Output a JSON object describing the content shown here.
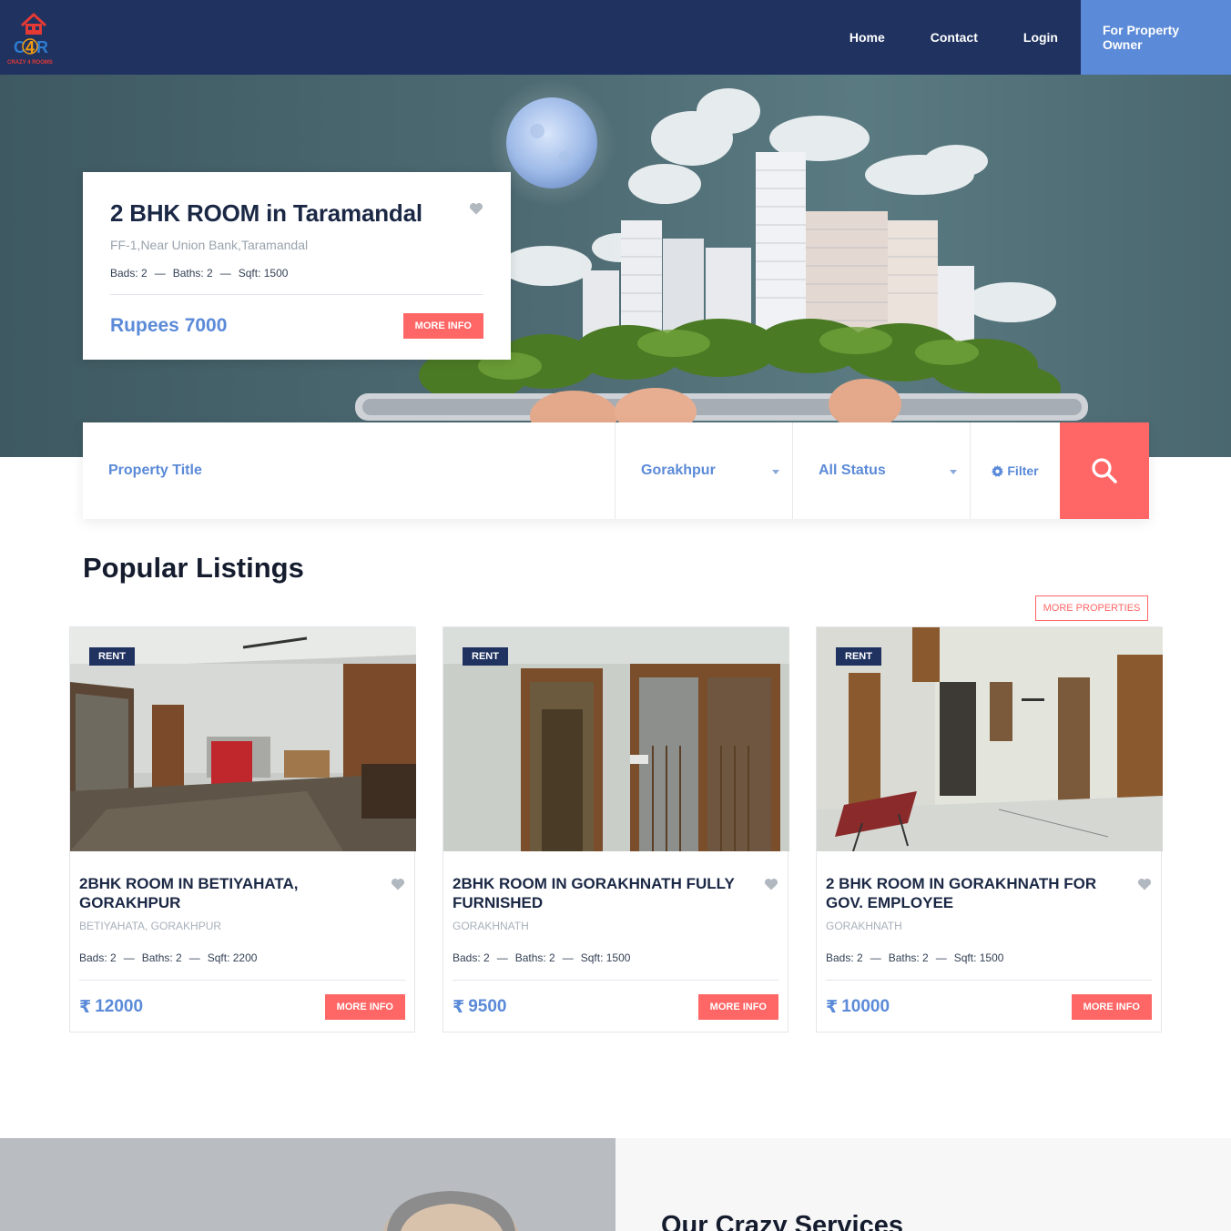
{
  "brand": {
    "logo_text": "C4R",
    "logo_subtext": "CRAZY 4 ROOMS"
  },
  "nav": {
    "items": [
      {
        "label": "Home"
      },
      {
        "label": "Contact"
      },
      {
        "label": "Login"
      },
      {
        "label": "For Property Owner"
      }
    ]
  },
  "featured": {
    "title": "2 BHK ROOM in Taramandal",
    "address": "FF-1,Near Union Bank,Taramandal",
    "beds": "Bads: 2",
    "baths": "Baths: 2",
    "sqft": "Sqft: 1500",
    "price": "Rupees 7000",
    "button": "MORE INFO"
  },
  "search": {
    "title_placeholder": "Property Title",
    "city": "Gorakhpur",
    "status": "All Status",
    "filter_label": "Filter"
  },
  "listings": {
    "heading": "Popular Listings",
    "more_button": "MORE PROPERTIES",
    "items": [
      {
        "badge": "RENT",
        "title": "2BHK ROOM IN BETIYAHATA, GORAKHPUR",
        "location": "BETIYAHATA, GORAKHPUR",
        "beds": "Bads: 2",
        "baths": "Baths: 2",
        "sqft": "Sqft: 2200",
        "price": "12000",
        "button": "MORE INFO"
      },
      {
        "badge": "RENT",
        "title": "2BHK ROOM IN GORAKHNATH FULLY FURNISHED",
        "location": "GORAKHNATH",
        "beds": "Bads: 2",
        "baths": "Baths: 2",
        "sqft": "Sqft: 1500",
        "price": "9500",
        "button": "MORE INFO"
      },
      {
        "badge": "RENT",
        "title": "2 BHK ROOM IN GORAKHNATH FOR GOV. EMPLOYEE",
        "location": "GORAKHNATH",
        "beds": "Bads: 2",
        "baths": "Baths: 2",
        "sqft": "Sqft: 1500",
        "price": "10000",
        "button": "MORE INFO"
      }
    ]
  },
  "services": {
    "heading": "Our Crazy Services"
  },
  "currency_symbol": "₹",
  "dash": "—",
  "colors": {
    "nav_bg": "#1f3260",
    "accent_blue": "#5b8ad8",
    "accent_red": "#ff6766"
  }
}
